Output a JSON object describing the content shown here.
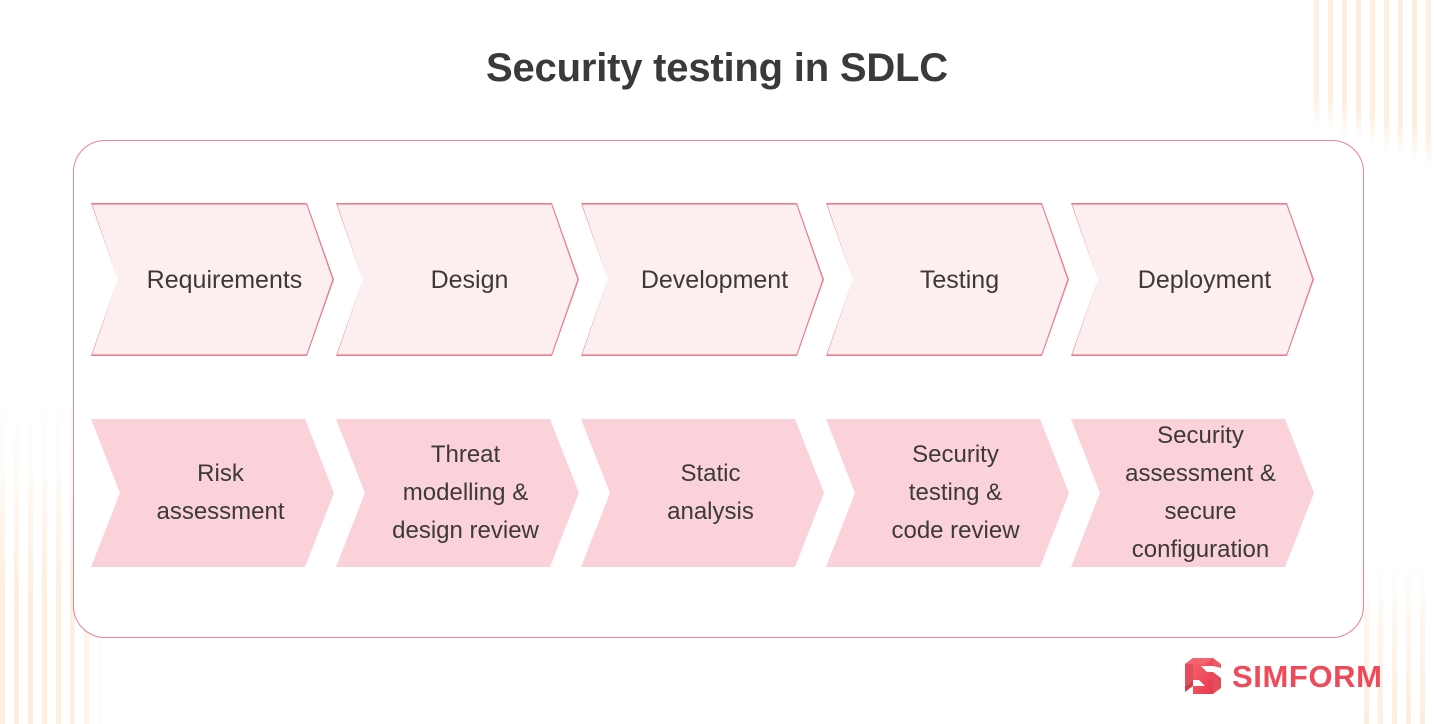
{
  "page": {
    "title": "Security testing in SDLC",
    "background_color": "#ffffff",
    "title_color": "#3b3a39"
  },
  "card": {
    "border_color": "#ef8193",
    "background_color": "#ffffff"
  },
  "decoration": {
    "stripe_color": "#fdeede",
    "stripe_regions": [
      "bottom-left",
      "top-right",
      "bottom-right"
    ]
  },
  "chart_data": {
    "type": "diagram",
    "diagram_kind": "two-row-chevron-process",
    "title": "Security testing in SDLC",
    "rows": [
      {
        "name": "sdlc-phases",
        "fill_color": "#fdeef0",
        "border_color": "#e8808f",
        "stages": [
          {
            "label": "Requirements"
          },
          {
            "label": "Design"
          },
          {
            "label": "Development"
          },
          {
            "label": "Testing"
          },
          {
            "label": "Deployment"
          }
        ]
      },
      {
        "name": "security-activities",
        "fill_color": "#fbd2da",
        "border_color": "none",
        "stages": [
          {
            "label": "Risk\nassessment"
          },
          {
            "label": "Threat\nmodelling &\ndesign review"
          },
          {
            "label": "Static\nanalysis"
          },
          {
            "label": "Security\ntesting &\ncode review"
          },
          {
            "label": "Security\nassessment &\nsecure\nconfiguration"
          }
        ]
      }
    ]
  },
  "logo": {
    "wordmark": "SIMFORM",
    "color": "#ef4a5a",
    "mark_name": "simform-cube-mark"
  }
}
